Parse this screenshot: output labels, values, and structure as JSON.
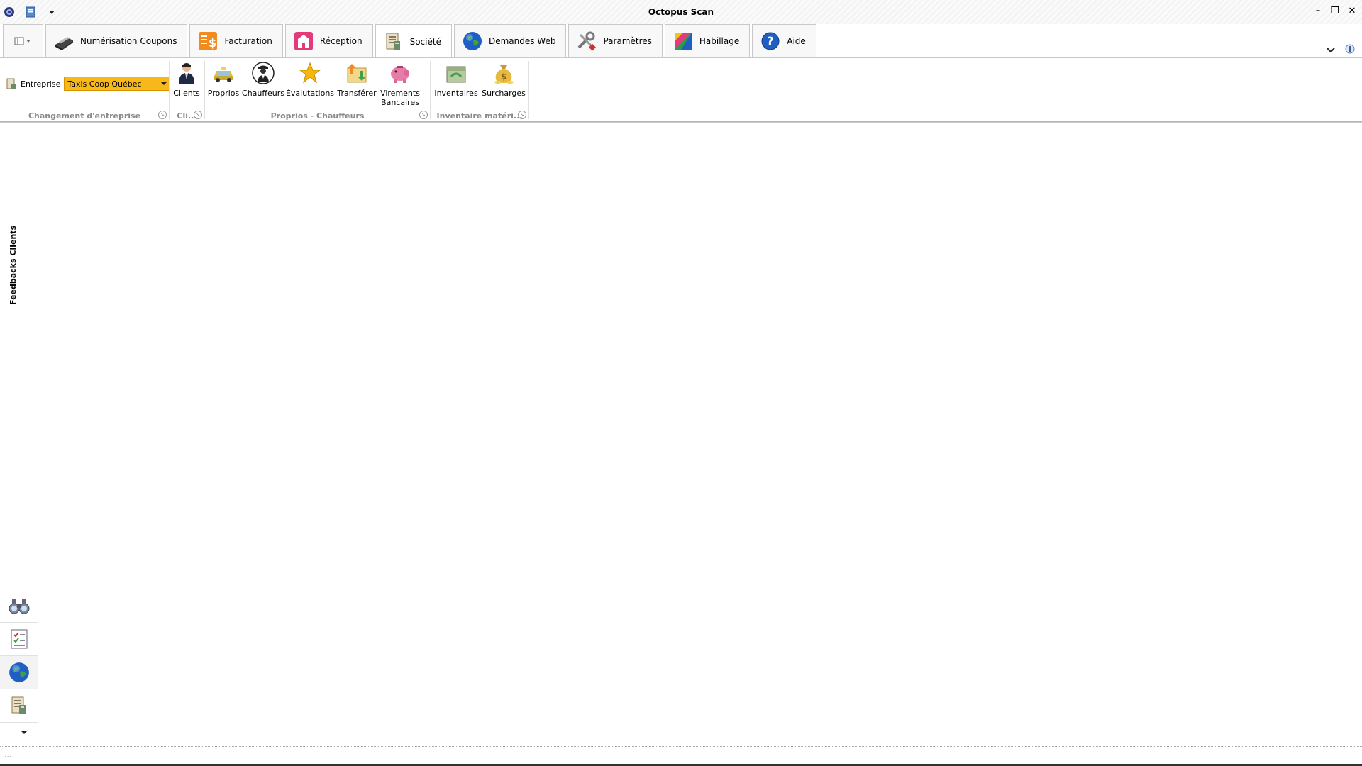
{
  "window": {
    "title": "Octopus Scan",
    "minimize": "–",
    "restore": "❐",
    "close": "✕"
  },
  "tabs": [
    {
      "label": "Numérisation Coupons",
      "icon": "scanner-icon"
    },
    {
      "label": "Facturation",
      "icon": "invoice-dollar-icon"
    },
    {
      "label": "Réception",
      "icon": "reception-icon"
    },
    {
      "label": "Société",
      "icon": "company-ledger-icon",
      "active": true
    },
    {
      "label": "Demandes Web",
      "icon": "globe-icon"
    },
    {
      "label": "Paramètres",
      "icon": "tools-icon"
    },
    {
      "label": "Habillage",
      "icon": "palette-icon"
    },
    {
      "label": "Aide",
      "icon": "help-icon"
    }
  ],
  "ribbon": {
    "entreprise_label": "Entreprise",
    "entreprise_value": "Taxis Coop Québec",
    "groups": {
      "changement": "Changement d'entreprise",
      "clients": "Cli...",
      "proprios": "Proprios - Chauffeurs",
      "inventaire": "Inventaire matéri..."
    },
    "buttons": {
      "clients": "Clients",
      "proprios": "Proprios",
      "chauffeurs": "Chauffeurs",
      "evaluations": "Évalutations",
      "transferer": "Transférer",
      "virements_1": "Virements",
      "virements_2": "Bancaires",
      "inventaires": "Inventaires",
      "surcharges": "Surcharges"
    }
  },
  "side_panel": {
    "label": "Feedbacks Clients"
  },
  "status": {
    "text": "..."
  },
  "colors": {
    "accent_combo": "#f9b81a"
  }
}
